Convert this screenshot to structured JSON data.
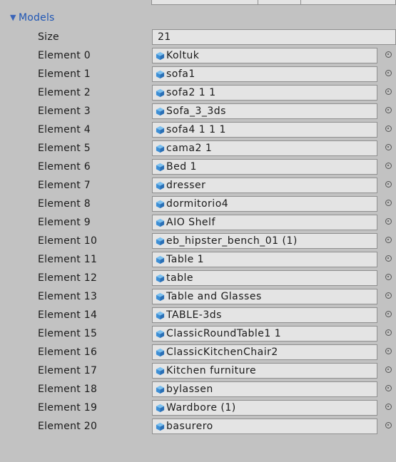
{
  "models": {
    "header_label": "Models",
    "size_label": "Size",
    "size_value": "21",
    "elements": [
      {
        "label": "Element 0",
        "value": "Koltuk"
      },
      {
        "label": "Element 1",
        "value": "sofa1"
      },
      {
        "label": "Element 2",
        "value": "sofa2 1 1"
      },
      {
        "label": "Element 3",
        "value": "Sofa_3_3ds"
      },
      {
        "label": "Element 4",
        "value": "sofa4 1 1 1"
      },
      {
        "label": "Element 5",
        "value": "cama2 1"
      },
      {
        "label": "Element 6",
        "value": "Bed 1"
      },
      {
        "label": "Element 7",
        "value": "dresser"
      },
      {
        "label": "Element 8",
        "value": "dormitorio4"
      },
      {
        "label": "Element 9",
        "value": "AIO Shelf"
      },
      {
        "label": "Element 10",
        "value": "eb_hipster_bench_01 (1)"
      },
      {
        "label": "Element 11",
        "value": "Table 1"
      },
      {
        "label": "Element 12",
        "value": "table"
      },
      {
        "label": "Element 13",
        "value": "Table and Glasses"
      },
      {
        "label": "Element 14",
        "value": "TABLE-3ds"
      },
      {
        "label": "Element 15",
        "value": "ClassicRoundTable1 1"
      },
      {
        "label": "Element 16",
        "value": "ClassicKitchenChair2"
      },
      {
        "label": "Element 17",
        "value": "Kitchen furniture"
      },
      {
        "label": "Element 18",
        "value": "bylassen"
      },
      {
        "label": "Element 19",
        "value": "Wardbore (1)"
      },
      {
        "label": "Element 20",
        "value": "basurero"
      }
    ]
  },
  "icons": {
    "foldout": "triangle-down-icon",
    "object": "prefab-cube-icon",
    "picker": "object-picker-icon"
  },
  "colors": {
    "background": "#c2c2c2",
    "field": "#e4e4e4",
    "header_text": "#1f56b5",
    "cube": "#3d8fd6"
  }
}
